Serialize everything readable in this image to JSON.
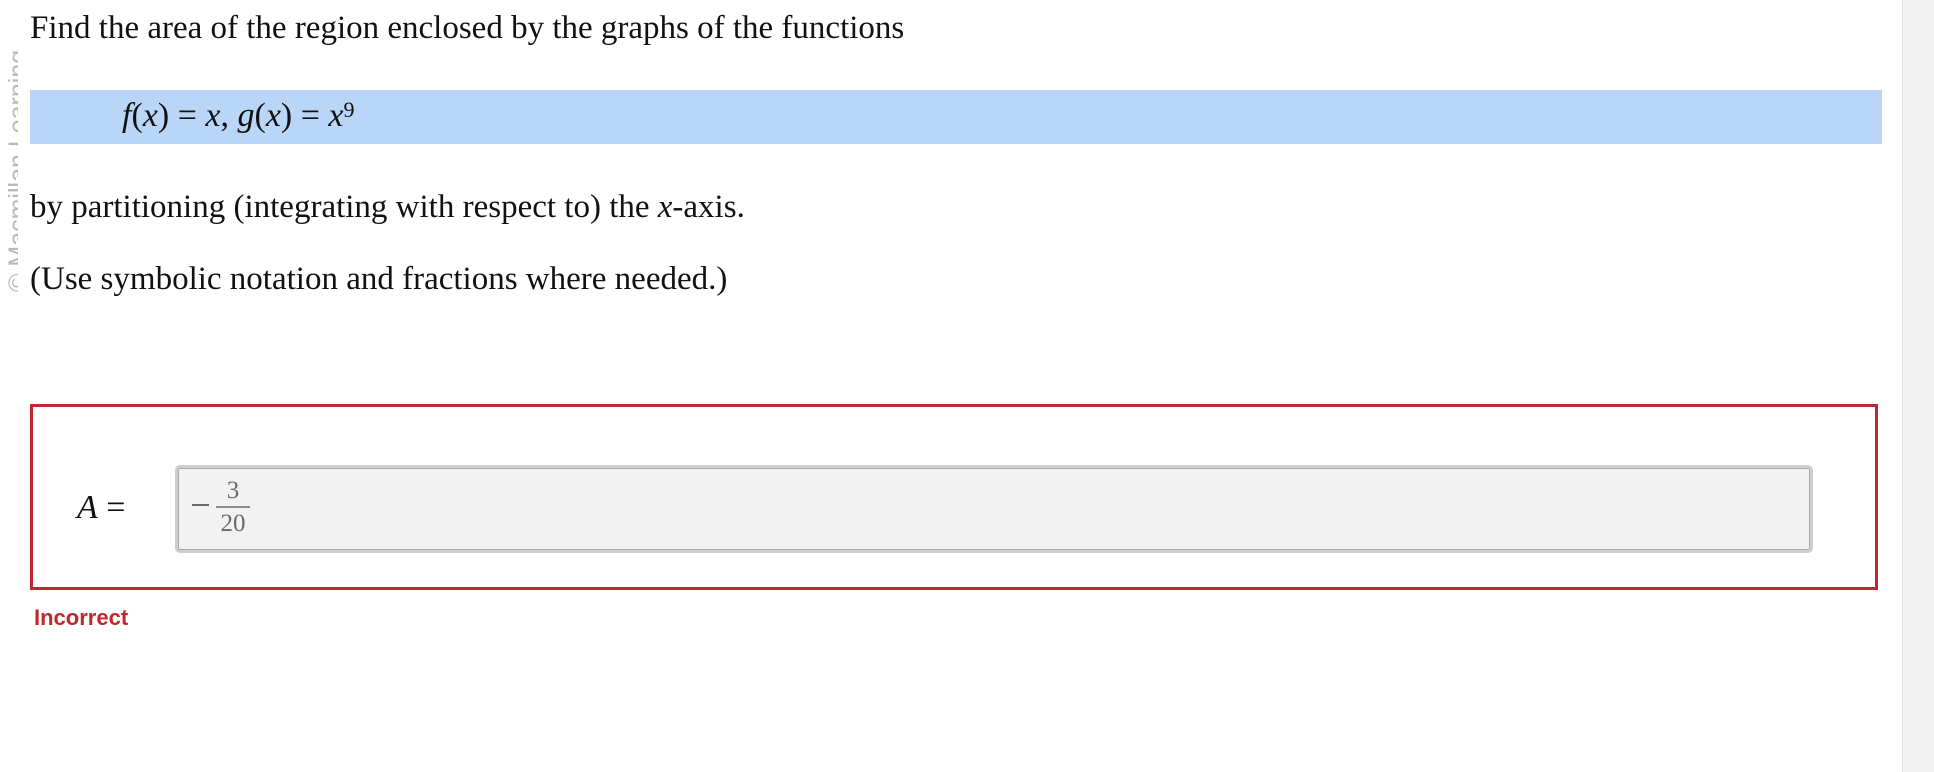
{
  "watermark": "© Macmillan Learning",
  "question": {
    "intro": "Find the area of the region enclosed by the graphs of the functions",
    "formula": {
      "f": "f",
      "x": "x",
      "open": "(",
      "close": ")",
      "equals": " = ",
      "comma": ", ",
      "g": "g",
      "exponent": "9"
    },
    "method_before": "by partitioning (integrating with respect to) the ",
    "method_var": "x",
    "method_after": "-axis.",
    "instruction": "(Use symbolic notation and fractions where needed.)"
  },
  "answer": {
    "label_var": "A",
    "label_equals": " =",
    "value": {
      "sign": "−",
      "numerator": "3",
      "denominator": "20"
    },
    "status": "Incorrect"
  },
  "colors": {
    "highlight": "#b9d6f8",
    "error": "#c1272d",
    "field_bg": "#f2f2f2"
  }
}
